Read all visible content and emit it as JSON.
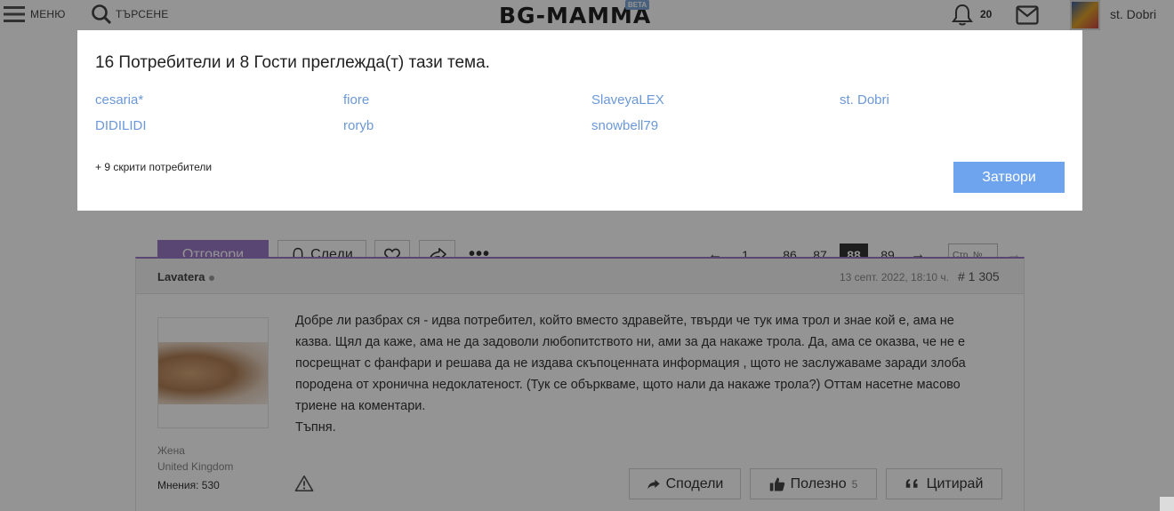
{
  "header": {
    "menu_label": "МЕНЮ",
    "search_label": "ТЪРСЕНЕ",
    "logo_text": "BG-MAMMA",
    "logo_badge": "BETA",
    "notifications_count": "20",
    "username": "st. Dobri"
  },
  "toolbar": {
    "reply_label": "Отговори",
    "follow_label": "Следи",
    "more_label": "•••"
  },
  "pagination": {
    "prev_arrow": "←",
    "pages": [
      "1",
      "...",
      "86",
      "87",
      "88",
      "89"
    ],
    "current_page": "88",
    "next_arrow": "→",
    "page_input_placeholder": "Стр. №",
    "go_arrow": "→"
  },
  "post": {
    "author": "Lavatera",
    "date": "13 септ. 2022, 18:10 ч.",
    "number": "# 1 305",
    "gender": "Жена",
    "country": "United Kingdom",
    "opinions": "Мнения: 530",
    "text_lines": [
      "Добре ли разбрах ся - идва потребител, който вместо здравейте, твърди че тук има трол и знае кой е, ама не",
      "казва. Щял да каже, ама не да задоволи любопитството ни, ами за да накаже трола. Да, ама се оказва, че не е",
      "посрещнат с фанфари и решава да не издава скъпоценната информация , щото не заслужаваме заради злоба",
      "породена от хронична недоклатеност. (Тук се объркваме, щото нали да накаже трола?) Оттам насетне масово",
      "триене на коментари.",
      "Тъпня."
    ],
    "actions": {
      "share_label": "Сподели",
      "useful_label": "Полезно",
      "useful_count": "5",
      "quote_label": "Цитирай"
    }
  },
  "modal": {
    "title": "16 Потребители и 8 Гости преглежда(т) тази тема.",
    "users": [
      "cesaria*",
      "fiore",
      "SlaveyaLEX",
      "st. Dobri",
      "DIDILIDI",
      "roryb",
      "snowbell79"
    ],
    "hidden_users": "+ 9 скрити потребители",
    "close_label": "Затвори"
  },
  "colors": {
    "accent_purple": "#9c79c6",
    "link_blue": "#6b98d8",
    "close_button": "#6ea4ee"
  }
}
